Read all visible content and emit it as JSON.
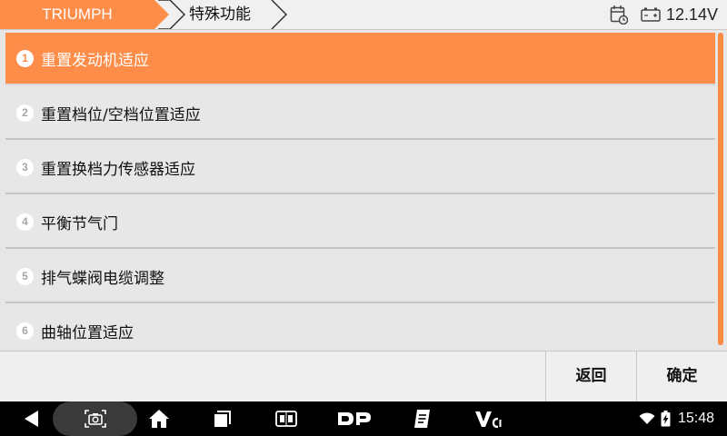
{
  "header": {
    "brand": "TRIUMPH",
    "function": "特殊功能",
    "voltage": "12.14V"
  },
  "list": {
    "items": [
      {
        "num": "1",
        "label": "重置发动机适应"
      },
      {
        "num": "2",
        "label": "重置档位/空档位置适应"
      },
      {
        "num": "3",
        "label": "重置换档力传感器适应"
      },
      {
        "num": "4",
        "label": "平衡节气门"
      },
      {
        "num": "5",
        "label": "排气蝶阀电缆调整"
      },
      {
        "num": "6",
        "label": "曲轴位置适应"
      }
    ]
  },
  "buttons": {
    "back": "返回",
    "ok": "确定"
  },
  "statusbar": {
    "time": "15:48"
  },
  "colors": {
    "accent": "#fd8d48",
    "row_bg": "#e7e7e7",
    "nav_bg": "#000000"
  }
}
